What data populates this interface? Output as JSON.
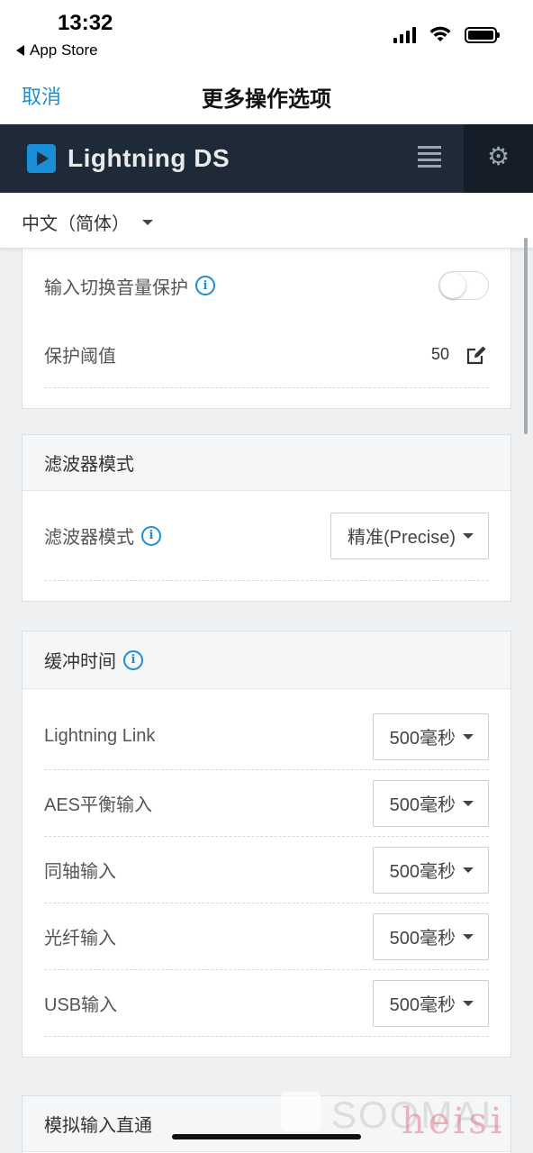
{
  "status_bar": {
    "time": "13:32",
    "back_app": "App Store"
  },
  "nav": {
    "cancel": "取消",
    "title": "更多操作选项"
  },
  "app_header": {
    "brand": "Lightning DS",
    "accent_color": "#1a8fd8",
    "background": "#1e2a38"
  },
  "language": {
    "selected": "中文（简体）"
  },
  "protection_card": {
    "rows": [
      {
        "label": "输入切换音量保护",
        "control": "toggle",
        "enabled": false
      },
      {
        "label": "保护阈值",
        "value": "50"
      }
    ]
  },
  "filter_card": {
    "title": "滤波器模式",
    "row": {
      "label": "滤波器模式",
      "selected": "精准(Precise)"
    }
  },
  "buffer_card": {
    "title": "缓冲时间",
    "rows": [
      {
        "label": "Lightning Link",
        "selected": "500毫秒"
      },
      {
        "label": "AES平衡输入",
        "selected": "500毫秒"
      },
      {
        "label": "同轴输入",
        "selected": "500毫秒"
      },
      {
        "label": "光纤输入",
        "selected": "500毫秒"
      },
      {
        "label": "USB输入",
        "selected": "500毫秒"
      }
    ]
  },
  "analog_card": {
    "title": "模拟输入直通"
  },
  "watermark": {
    "brand": "SOOMAL",
    "overlay": "heisi"
  }
}
